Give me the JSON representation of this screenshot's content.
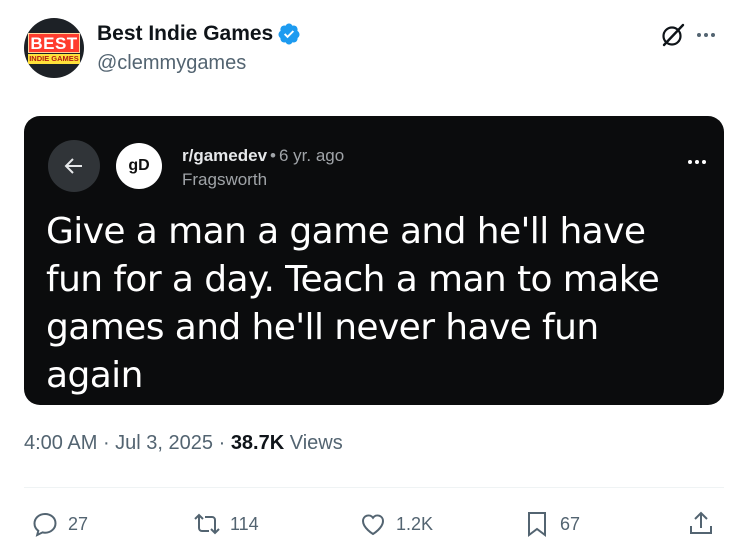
{
  "account": {
    "display_name": "Best Indie Games",
    "handle": "@clemmygames",
    "avatar_text_top": "BEST",
    "avatar_text_bottom": "INDIE GAMES"
  },
  "header_icons": [
    "grok-icon",
    "more-icon"
  ],
  "media": {
    "subreddit": "r/gamedev",
    "age": "6 yr. ago",
    "author": "Fragsworth",
    "sub_avatar_text": "gD",
    "quote": "Give a man a game and he'll have fun for a day. Teach a man to make games and he'll never have fun again"
  },
  "meta": {
    "time": "4:00 AM",
    "date": "Jul 3, 2025",
    "views_count": "38.7K",
    "views_label": "Views"
  },
  "actions": {
    "replies": "27",
    "reposts": "114",
    "likes": "1.2K",
    "bookmarks": "67"
  },
  "colors": {
    "verified": "#1d9bf0",
    "muted": "#536471",
    "media_bg": "#0b0c0d"
  }
}
